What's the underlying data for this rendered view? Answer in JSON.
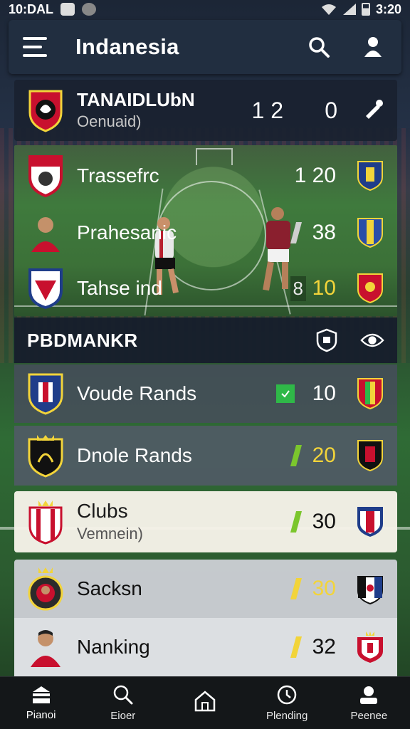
{
  "status_bar": {
    "time": "10:DAL",
    "right_text": "3:20"
  },
  "header": {
    "title": "Indanesia"
  },
  "top_card": {
    "name": "TANAIDLUbN",
    "sub": "Oenuaid)",
    "score": "1 2",
    "score_alt": "0"
  },
  "field_rows": [
    {
      "name": "Trassefrc",
      "score": "1 20",
      "marker_color": "",
      "score_color": "#ffffff"
    },
    {
      "name": "Prahesanic",
      "score": "38",
      "marker_color": "#cfcfcf",
      "score_color": "#ffffff"
    },
    {
      "name": "Tahse ind",
      "score_prefix": "8",
      "score": "10",
      "marker_color": "",
      "score_color": "#f2d43a"
    }
  ],
  "section": {
    "title": "PBDMANKR"
  },
  "list_rows": [
    {
      "name": "Voude Rands",
      "score": "10",
      "score_color": "#ffffff"
    },
    {
      "name": "Dnole Rands",
      "score": "20",
      "score_color": "#f2d43a"
    },
    {
      "name": "Clubs",
      "sub": "Vemnein)",
      "score": "30",
      "score_color": "#111111"
    },
    {
      "name": "Sacksn",
      "score": "30",
      "score_color": "#f2d43a"
    },
    {
      "name": "Nanking",
      "score": "32",
      "score_color": "#111111"
    }
  ],
  "nav": [
    {
      "label": "Pianoi",
      "icon": "home-icon"
    },
    {
      "label": "Eioer",
      "icon": "search-icon"
    },
    {
      "label": "",
      "icon": "house-icon"
    },
    {
      "label": "Plending",
      "icon": "clock-icon"
    },
    {
      "label": "Peenee",
      "icon": "profile-icon"
    }
  ],
  "colors": {
    "accent_green": "#7bc62d",
    "accent_yellow": "#f2d43a",
    "header_bg": "#222e40"
  }
}
